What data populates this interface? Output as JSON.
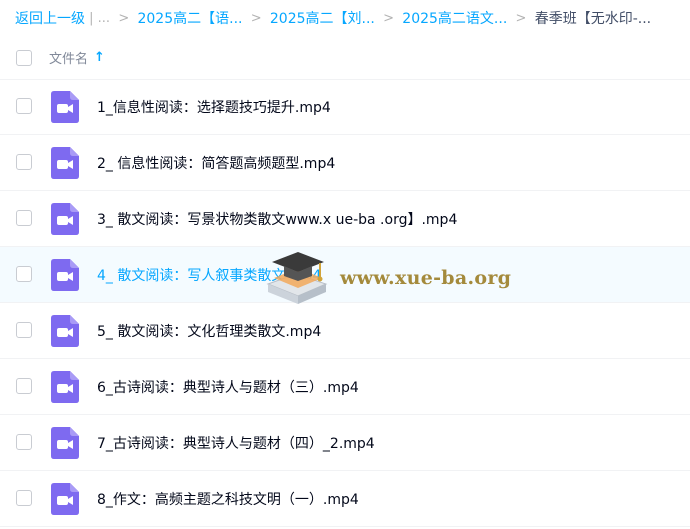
{
  "breadcrumb": {
    "back": "返回上一级",
    "ellipsis": "...",
    "items": [
      "2025高二【语...",
      "2025高二【刘...",
      "2025高二语文..."
    ],
    "current": "春季班【无水印-..."
  },
  "header": {
    "name_column": "文件名",
    "sort_arrow": "↑"
  },
  "files": [
    {
      "name": "1_信息性阅读：选择题技巧提升.mp4"
    },
    {
      "name": "2_ 信息性阅读：简答题高频题型.mp4"
    },
    {
      "name": "3_ 散文阅读：写景状物类散文www.x ue-ba .org】.mp4"
    },
    {
      "name": "4_ 散文阅读：写人叙事类散文.mp4"
    },
    {
      "name": "5_ 散文阅读：文化哲理类散文.mp4"
    },
    {
      "name": "6_古诗阅读：典型诗人与题材（三）.mp4"
    },
    {
      "name": "7_古诗阅读：典型诗人与题材（四）_2.mp4"
    },
    {
      "name": "8_作文：高频主题之科技文明（一）.mp4"
    }
  ],
  "hovered_row_index": 3,
  "watermark": {
    "text": "www.xue-ba.org",
    "icon": "graduation-cap-book-icon"
  },
  "colors": {
    "link": "#06a7ff",
    "video_icon": "#7e6af0",
    "hover_row": "#f4fbff",
    "watermark_text": "#a48a3c"
  },
  "icons": {
    "file": "video-file-icon"
  }
}
